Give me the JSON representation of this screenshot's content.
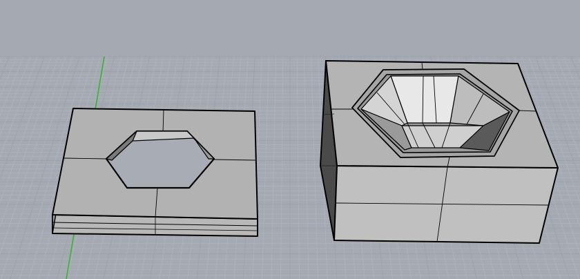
{
  "viewport": {
    "projection": "perspective",
    "background_color": "#a4a9b2",
    "grid_minor_color": "#b2b7bf",
    "grid_major_color": "#9ca1aa",
    "axis_x_color": "#c04040",
    "axis_y_color": "#33b533",
    "edge_color": "#000000",
    "shade_color": "#b2b2b2",
    "highlight_color": "#e6e6e6",
    "dark_color": "#3a3a3a",
    "grid_visible": true
  },
  "objects": [
    {
      "kind": "plate-with-hexagon-hole",
      "shading": "shaded"
    },
    {
      "kind": "block-with-hexagon-funnel",
      "shading": "shaded"
    }
  ]
}
